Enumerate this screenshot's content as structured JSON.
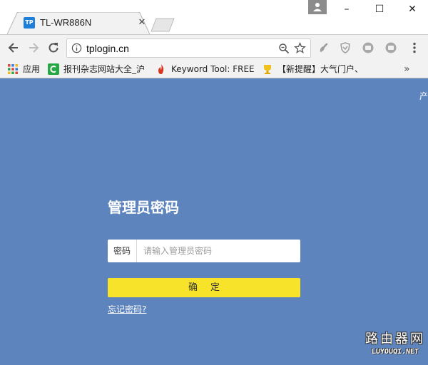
{
  "browser": {
    "tab": {
      "title": "TL-WR886N",
      "favicon_text": "TP",
      "close_symbol": "✕"
    },
    "window_controls": {
      "minimize": "–",
      "maximize": "☐",
      "close": "✕"
    },
    "address_bar": {
      "url": "tplogin.cn"
    },
    "bookmarks": [
      {
        "label": "应用",
        "icon": "apps-grid-icon"
      },
      {
        "label": "报刊杂志网站大全_沪",
        "icon": "green-c-icon"
      },
      {
        "label": "Keyword Tool: FREE",
        "icon": "flame-icon"
      },
      {
        "label": "【新提醒】大气门户、",
        "icon": "trophy-icon"
      }
    ],
    "bookmarks_overflow": "»"
  },
  "page": {
    "corner_text": "产",
    "title": "管理员密码",
    "password": {
      "label": "密码",
      "placeholder": "请输入管理员密码"
    },
    "confirm_label": "确定",
    "forgot_label": "忘记密码?"
  },
  "watermark": {
    "main": "路由器网",
    "sub": "LUYOUQI.NET"
  },
  "colors": {
    "page_background": "#5d84bd",
    "confirm_button": "#f7e42a",
    "favicon": "#1f7fd8"
  }
}
